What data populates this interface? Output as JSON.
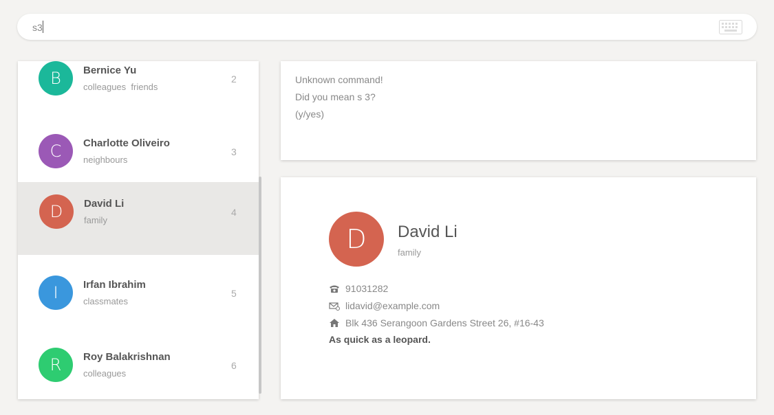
{
  "command": {
    "value": "s3",
    "icon": "keyboard-icon"
  },
  "persons": [
    {
      "initial": "B",
      "name": "Bernice Yu",
      "tags": "colleagues  friends",
      "index": "2",
      "color": "#1bb89a"
    },
    {
      "initial": "C",
      "name": "Charlotte Oliveiro",
      "tags": "neighbours",
      "index": "3",
      "color": "#9b59b6"
    },
    {
      "initial": "D",
      "name": "David Li",
      "tags": "family",
      "index": "4",
      "color": "#d46450"
    },
    {
      "initial": "I",
      "name": "Irfan Ibrahim",
      "tags": "classmates",
      "index": "5",
      "color": "#3a97dd"
    },
    {
      "initial": "R",
      "name": "Roy Balakrishnan",
      "tags": "colleagues",
      "index": "6",
      "color": "#2ecc71"
    }
  ],
  "selected_person_index": "4",
  "result": {
    "line1": "Unknown command!",
    "line2": "Did you mean s 3?",
    "line3": "(y/yes)"
  },
  "detail": {
    "initial": "D",
    "name": "David Li",
    "tag": "family",
    "phone": "91031282",
    "email": "lidavid@example.com",
    "address": "Blk 436 Serangoon Gardens Street 26, #16-43",
    "remark": "As quick as a leopard.",
    "phone_icon": "phone-icon",
    "email_icon": "email-icon",
    "address_icon": "home-icon"
  }
}
